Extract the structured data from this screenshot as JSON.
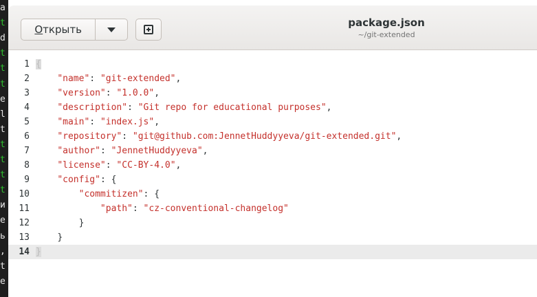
{
  "background_terminal": {
    "lines": [
      {
        "text": "a",
        "green": false
      },
      {
        "text": "t",
        "green": true
      },
      {
        "text": "d",
        "green": false
      },
      {
        "text": "t",
        "green": true
      },
      {
        "text": "t",
        "green": true
      },
      {
        "text": "t",
        "green": true
      },
      {
        "text": "e",
        "green": false
      },
      {
        "text": "l",
        "green": false
      },
      {
        "text": "t",
        "green": false
      },
      {
        "text": "t",
        "green": true
      },
      {
        "text": "t",
        "green": true
      },
      {
        "text": "t",
        "green": true
      },
      {
        "text": "t",
        "green": true
      },
      {
        "text": "и",
        "green": false
      },
      {
        "text": "e",
        "green": false
      },
      {
        "text": "ь",
        "green": false
      },
      {
        "text": ",",
        "green": false
      },
      {
        "text": "t",
        "green": false
      },
      {
        "text": "e",
        "green": false
      }
    ]
  },
  "headerbar": {
    "open_button_label_underlined": "О",
    "open_button_label_rest": "ткрыть",
    "open_dropdown_icon": "chevron-down-icon",
    "new_tab_icon": "plus-box-icon",
    "title": "package.json",
    "subtitle": "~/git-extended"
  },
  "editor": {
    "current_line": 14,
    "colors": {
      "string": "#c4302b",
      "text": "#2e3436",
      "current_line_bg": "#ebebeb"
    },
    "lines": [
      {
        "n": "1",
        "indent": "",
        "key": "",
        "sep": "",
        "value": "",
        "tail": "",
        "bracket": "{",
        "bracket_hl": true
      },
      {
        "n": "2",
        "indent": "    ",
        "key": "\"name\"",
        "sep": ": ",
        "value": "\"git-extended\"",
        "tail": ",",
        "bracket": "",
        "bracket_hl": false
      },
      {
        "n": "3",
        "indent": "    ",
        "key": "\"version\"",
        "sep": ": ",
        "value": "\"1.0.0\"",
        "tail": ",",
        "bracket": "",
        "bracket_hl": false
      },
      {
        "n": "4",
        "indent": "    ",
        "key": "\"description\"",
        "sep": ": ",
        "value": "\"Git repo for educational purposes\"",
        "tail": ",",
        "bracket": "",
        "bracket_hl": false
      },
      {
        "n": "5",
        "indent": "    ",
        "key": "\"main\"",
        "sep": ": ",
        "value": "\"index.js\"",
        "tail": ",",
        "bracket": "",
        "bracket_hl": false
      },
      {
        "n": "6",
        "indent": "    ",
        "key": "\"repository\"",
        "sep": ": ",
        "value": "\"git@github.com:JennetHuddyyeva/git-extended.git\"",
        "tail": ",",
        "bracket": "",
        "bracket_hl": false
      },
      {
        "n": "7",
        "indent": "    ",
        "key": "\"author\"",
        "sep": ": ",
        "value": "\"JennetHuddyyeva\"",
        "tail": ",",
        "bracket": "",
        "bracket_hl": false
      },
      {
        "n": "8",
        "indent": "    ",
        "key": "\"license\"",
        "sep": ": ",
        "value": "\"CC-BY-4.0\"",
        "tail": ",",
        "bracket": "",
        "bracket_hl": false
      },
      {
        "n": "9",
        "indent": "    ",
        "key": "\"config\"",
        "sep": ": ",
        "value": "",
        "tail": "{",
        "bracket": "",
        "bracket_hl": false
      },
      {
        "n": "10",
        "indent": "        ",
        "key": "\"commitizen\"",
        "sep": ": ",
        "value": "",
        "tail": "{",
        "bracket": "",
        "bracket_hl": false
      },
      {
        "n": "11",
        "indent": "            ",
        "key": "\"path\"",
        "sep": ": ",
        "value": "\"cz-conventional-changelog\"",
        "tail": "",
        "bracket": "",
        "bracket_hl": false
      },
      {
        "n": "12",
        "indent": "        ",
        "key": "",
        "sep": "",
        "value": "",
        "tail": "}",
        "bracket": "",
        "bracket_hl": false
      },
      {
        "n": "13",
        "indent": "    ",
        "key": "",
        "sep": "",
        "value": "",
        "tail": "}",
        "bracket": "",
        "bracket_hl": false
      },
      {
        "n": "14",
        "indent": "",
        "key": "",
        "sep": "",
        "value": "",
        "tail": "",
        "bracket": "}",
        "bracket_hl": true
      }
    ]
  }
}
